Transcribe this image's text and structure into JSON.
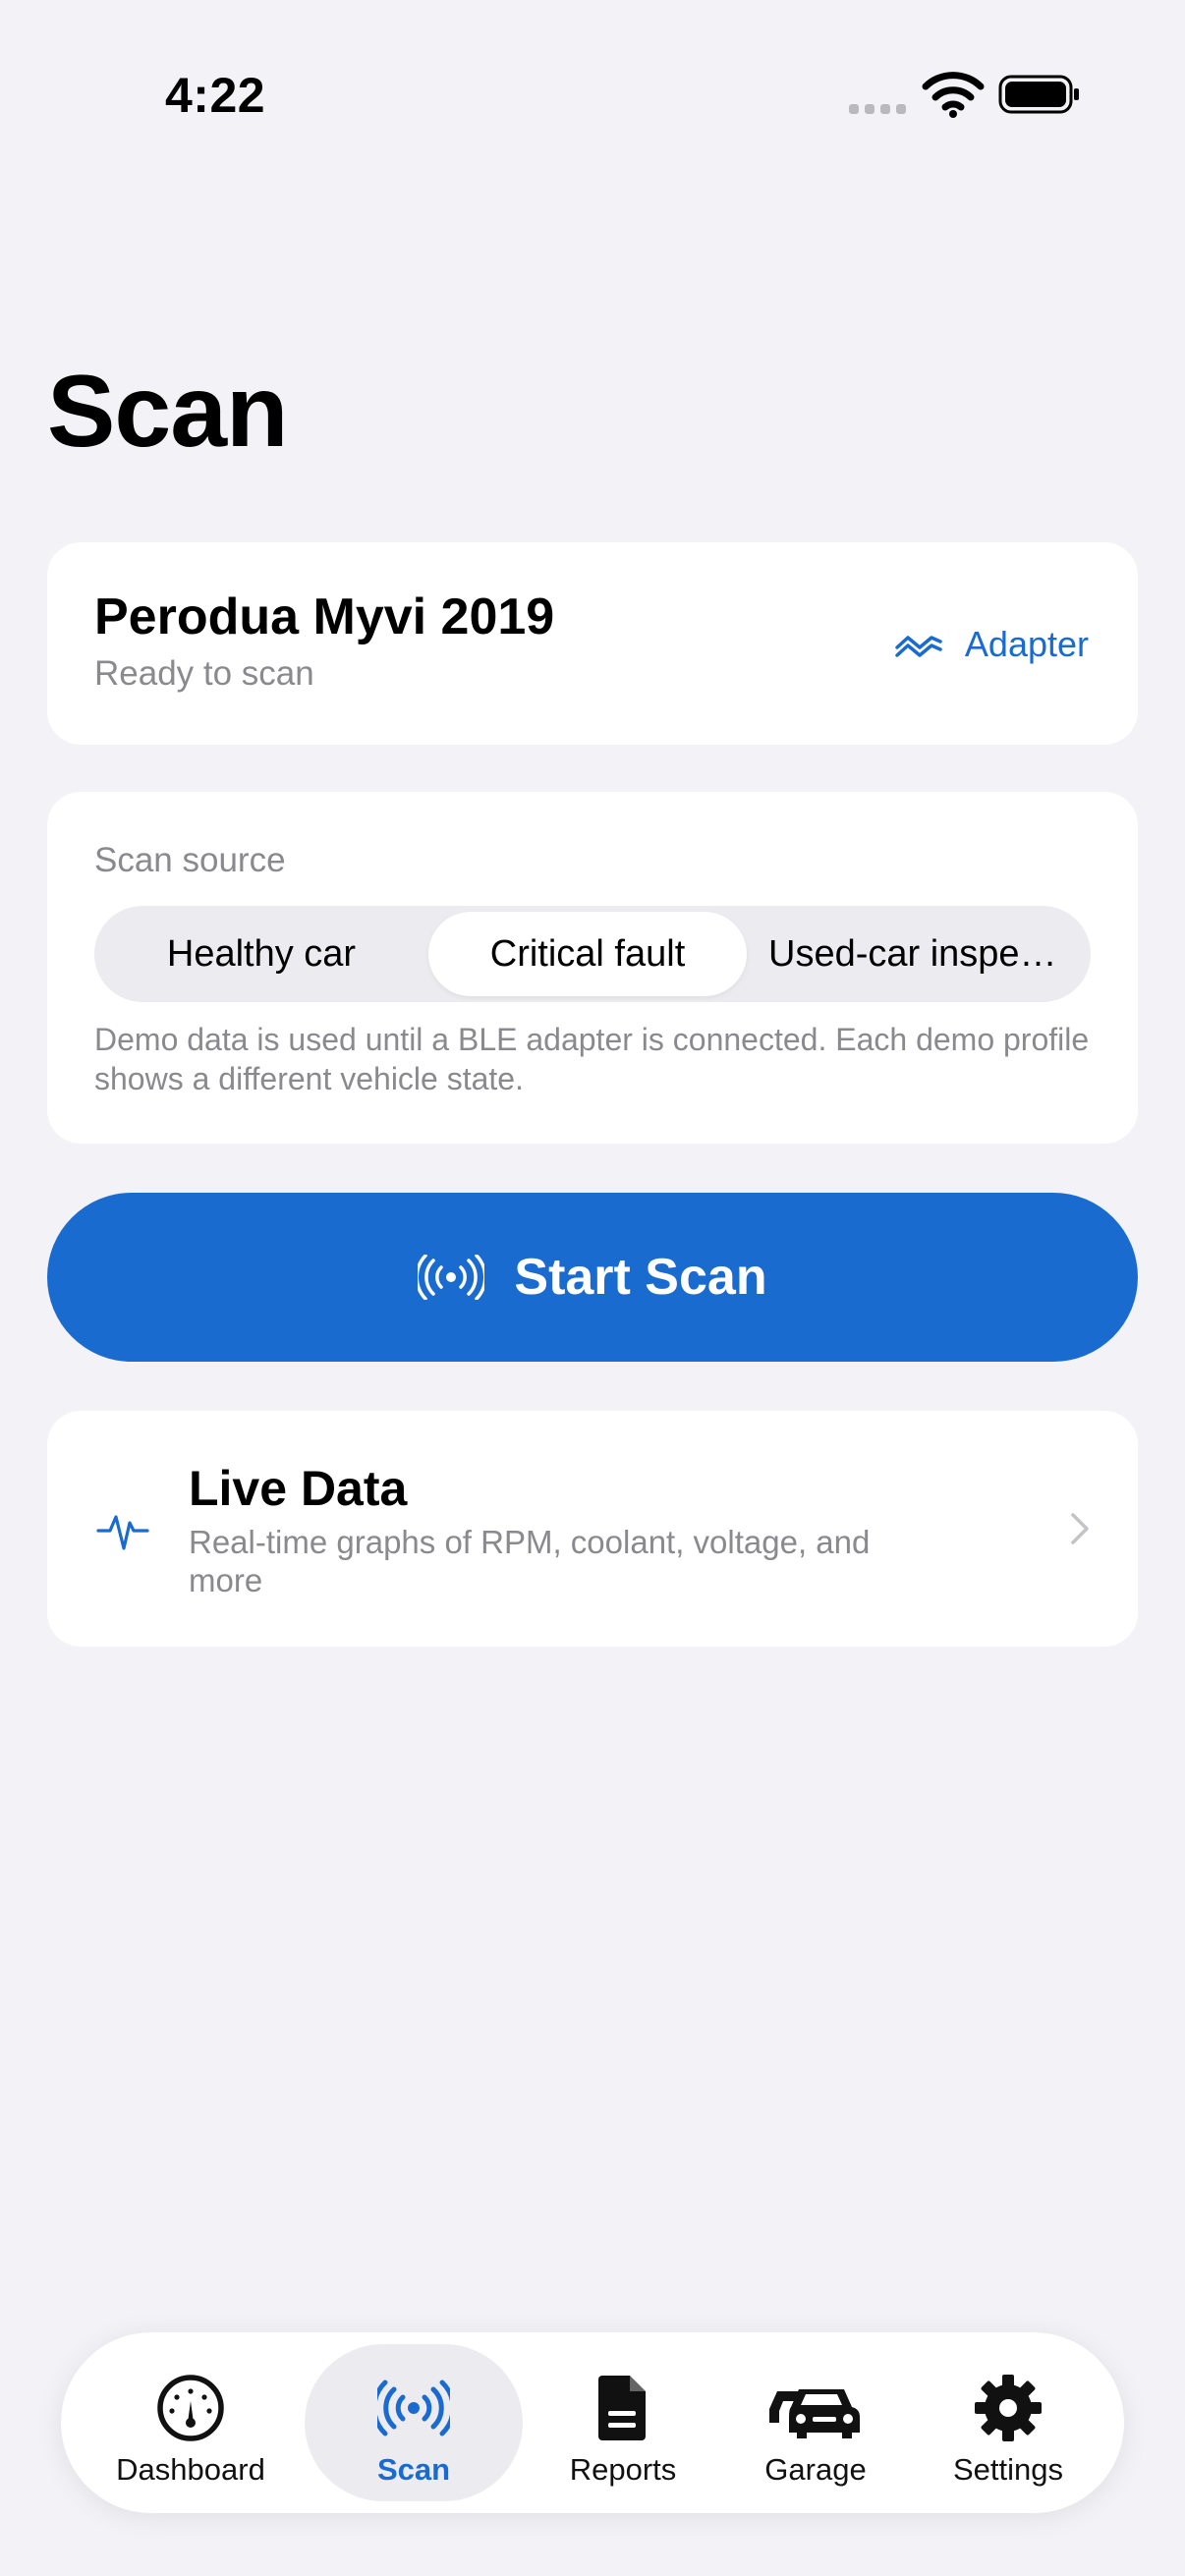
{
  "status_bar": {
    "time": "4:22"
  },
  "page": {
    "title": "Scan"
  },
  "vehicle": {
    "name": "Perodua Myvi 2019",
    "status": "Ready to scan",
    "adapter_label": "Adapter"
  },
  "scan_source": {
    "label": "Scan source",
    "options": [
      "Healthy car",
      "Critical fault",
      "Used-car inspe…"
    ],
    "selected": "Critical fault",
    "note": "Demo data is used until a BLE adapter is connected. Each demo profile shows a different vehicle state."
  },
  "start_scan": {
    "label": "Start Scan"
  },
  "live_data": {
    "title": "Live Data",
    "subtitle": "Real-time graphs of RPM, coolant, voltage, and more"
  },
  "tab_bar": {
    "items": [
      {
        "label": "Dashboard",
        "icon": "gauge-icon"
      },
      {
        "label": "Scan",
        "icon": "antenna-icon"
      },
      {
        "label": "Reports",
        "icon": "document-icon"
      },
      {
        "label": "Garage",
        "icon": "cars-icon"
      },
      {
        "label": "Settings",
        "icon": "gear-icon"
      }
    ],
    "active": "Scan"
  },
  "colors": {
    "accent": "#1a6bd0",
    "background": "#f2f2f7",
    "secondary_text": "#8a8a8e",
    "card": "#ffffff"
  }
}
